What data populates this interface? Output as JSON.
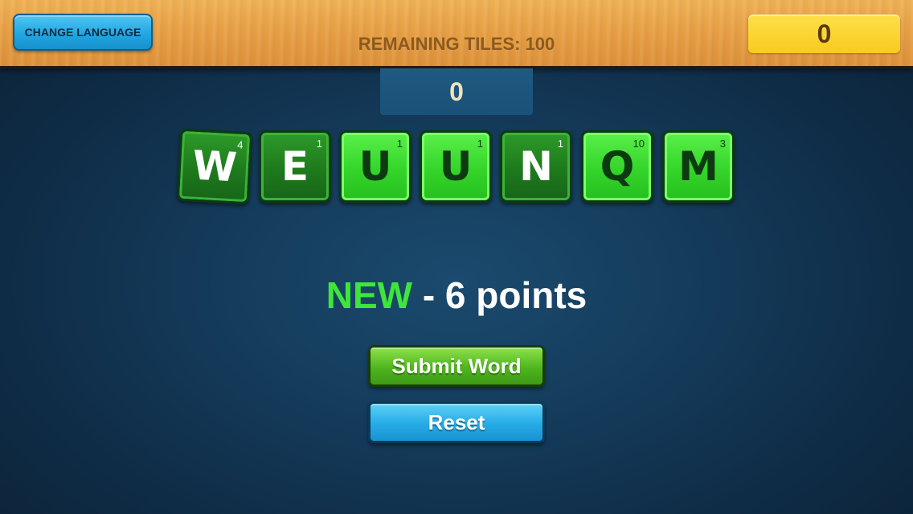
{
  "header": {
    "change_language_label": "CHANGE LANGUAGE",
    "remaining_tiles_label": "REMAINING TILES: 100",
    "score": "0"
  },
  "word_score": "0",
  "tiles": [
    {
      "letter": "W",
      "value": "4",
      "style": "dark"
    },
    {
      "letter": "E",
      "value": "1",
      "style": "dark"
    },
    {
      "letter": "U",
      "value": "1",
      "style": "light"
    },
    {
      "letter": "U",
      "value": "1",
      "style": "light"
    },
    {
      "letter": "N",
      "value": "1",
      "style": "dark"
    },
    {
      "letter": "Q",
      "value": "10",
      "style": "light"
    },
    {
      "letter": "M",
      "value": "3",
      "style": "light"
    }
  ],
  "result": {
    "word": "NEW",
    "points_text": " - 6 points"
  },
  "buttons": {
    "submit_label": "Submit Word",
    "reset_label": "Reset"
  },
  "colors": {
    "tile_dark": "#1e7a1c",
    "tile_light": "#34d52a",
    "word_highlight": "#3ee63a",
    "score_box": "#f8cb1e",
    "wood": "#e8a146"
  }
}
